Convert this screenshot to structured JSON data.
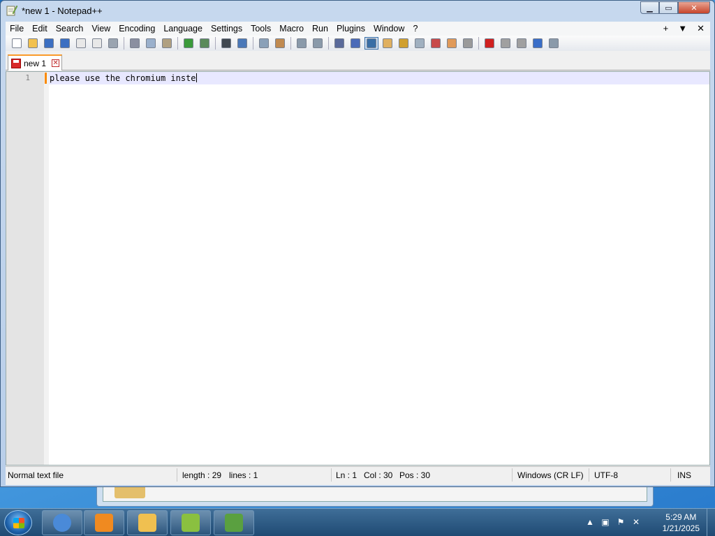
{
  "window": {
    "title": "*new 1 - Notepad++",
    "minimize_glyph": "▁",
    "maximize_glyph": "▭",
    "close_glyph": "✕"
  },
  "menu": {
    "items": [
      "File",
      "Edit",
      "Search",
      "View",
      "Encoding",
      "Language",
      "Settings",
      "Tools",
      "Macro",
      "Run",
      "Plugins",
      "Window",
      "?"
    ],
    "right_add": "+",
    "right_dropdown": "▼",
    "right_close": "✕"
  },
  "toolbar": {
    "buttons": [
      {
        "icon": "new-file-icon",
        "color": "#ffffff"
      },
      {
        "icon": "open-file-icon",
        "color": "#f2c14e"
      },
      {
        "icon": "save-icon",
        "color": "#3b6fc2"
      },
      {
        "icon": "save-all-icon",
        "color": "#3b6fc2"
      },
      {
        "icon": "close-icon",
        "color": "#e8e8e8"
      },
      {
        "icon": "close-all-icon",
        "color": "#e8e8e8"
      },
      {
        "icon": "print-icon",
        "color": "#9aa4b0"
      },
      {
        "sep": true
      },
      {
        "icon": "cut-icon",
        "color": "#8a8fa0"
      },
      {
        "icon": "copy-icon",
        "color": "#9ab0cc"
      },
      {
        "icon": "paste-icon",
        "color": "#b0a080"
      },
      {
        "sep": true
      },
      {
        "icon": "undo-icon",
        "color": "#3a9a3a"
      },
      {
        "icon": "redo-icon",
        "color": "#5a8a5a"
      },
      {
        "sep": true
      },
      {
        "icon": "find-icon",
        "color": "#404850"
      },
      {
        "icon": "replace-icon",
        "color": "#4a78b8"
      },
      {
        "sep": true
      },
      {
        "icon": "zoom-in-icon",
        "color": "#8aa0b8"
      },
      {
        "icon": "zoom-out-icon",
        "color": "#c08a50"
      },
      {
        "sep": true
      },
      {
        "icon": "sync-vertical-icon",
        "color": "#8a9aaa"
      },
      {
        "icon": "sync-horizontal-icon",
        "color": "#8a9aaa"
      },
      {
        "sep": true
      },
      {
        "icon": "word-wrap-icon",
        "color": "#5a6a9a"
      },
      {
        "icon": "show-all-chars-icon",
        "color": "#4a6ab8"
      },
      {
        "icon": "indent-guide-icon",
        "color": "#3a6ea5",
        "selected": true
      },
      {
        "icon": "udl-icon",
        "color": "#e0b060"
      },
      {
        "icon": "doc-map-icon",
        "color": "#d0a030"
      },
      {
        "icon": "doc-list-icon",
        "color": "#a0b0c0"
      },
      {
        "icon": "function-list-icon",
        "color": "#c84a4a"
      },
      {
        "icon": "folder-as-workspace-icon",
        "color": "#e09a5a"
      },
      {
        "icon": "monitoring-icon",
        "color": "#9a9a9a"
      },
      {
        "sep": true
      },
      {
        "icon": "record-macro-icon",
        "color": "#d02020"
      },
      {
        "icon": "stop-record-icon",
        "color": "#a0a0a0"
      },
      {
        "icon": "playback-icon",
        "color": "#a0a0a0"
      },
      {
        "icon": "run-macro-multiple-icon",
        "color": "#3a6ec8"
      },
      {
        "icon": "save-macro-icon",
        "color": "#8a9aaa"
      }
    ]
  },
  "tab": {
    "label": "new 1",
    "close_glyph": "✕"
  },
  "editor": {
    "line_numbers": [
      "1"
    ],
    "text": "please use the chromium inste"
  },
  "status": {
    "type": "Normal text file",
    "length": "length : 29",
    "lines": "lines : 1",
    "ln": "Ln : 1",
    "col": "Col : 30",
    "pos": "Pos : 30",
    "eol": "Windows (CR LF)",
    "encoding": "UTF-8",
    "mode": "INS"
  },
  "taskbar": {
    "apps": [
      {
        "icon": "chrome-icon",
        "color": "#4a8ad8"
      },
      {
        "icon": "media-player-icon",
        "color": "#f08a20"
      },
      {
        "icon": "file-explorer-icon",
        "color": "#f0c050"
      },
      {
        "icon": "notepadpp-icon",
        "color": "#8ac040"
      },
      {
        "icon": "notepadpp-chameleon-icon",
        "color": "#5aa040"
      }
    ],
    "time": "5:29 AM",
    "date": "1/21/2025"
  }
}
